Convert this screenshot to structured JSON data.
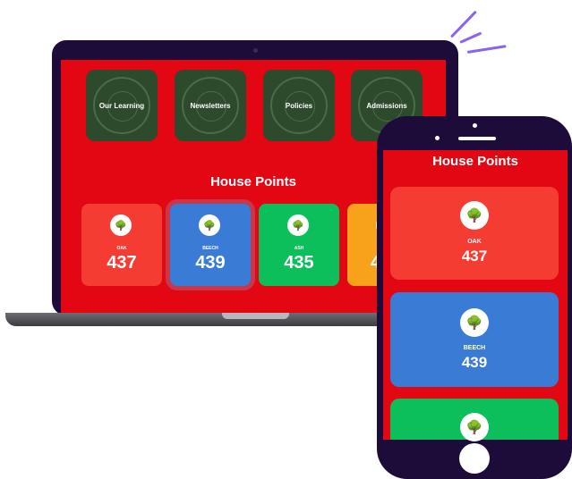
{
  "colors": {
    "background": "#ffffff",
    "device_frame": "#1d0b3a",
    "screen_red": "#e30613",
    "tile_green": "#2d4a2c",
    "oak": "#f43c32",
    "beech": "#3a7bd5",
    "ash": "#0cbf5a",
    "fourth": "#f8a21b",
    "accent_stroke": "#8a63ee"
  },
  "laptop": {
    "nav_tiles": [
      {
        "label": "Our Learning"
      },
      {
        "label": "Newsletters"
      },
      {
        "label": "Policies"
      },
      {
        "label": "Admissions"
      }
    ],
    "house_points_title": "House Points",
    "houses": [
      {
        "name": "OAK",
        "points": "437",
        "color": "#f43c32",
        "icon": "tree-icon"
      },
      {
        "name": "BEECH",
        "points": "439",
        "color": "#3a7bd5",
        "icon": "tree-icon"
      },
      {
        "name": "ASH",
        "points": "435",
        "color": "#0cbf5a",
        "icon": "tree-icon"
      },
      {
        "name": "",
        "points": "4",
        "color": "#f8a21b",
        "icon": "tree-icon"
      }
    ]
  },
  "phone": {
    "house_points_title": "House Points",
    "houses": [
      {
        "name": "OAK",
        "points": "437",
        "color": "#f43c32",
        "icon": "tree-icon"
      },
      {
        "name": "BEECH",
        "points": "439",
        "color": "#3a7bd5",
        "icon": "tree-icon"
      },
      {
        "name": "",
        "points": "",
        "color": "#0cbf5a",
        "icon": "tree-icon"
      }
    ]
  }
}
